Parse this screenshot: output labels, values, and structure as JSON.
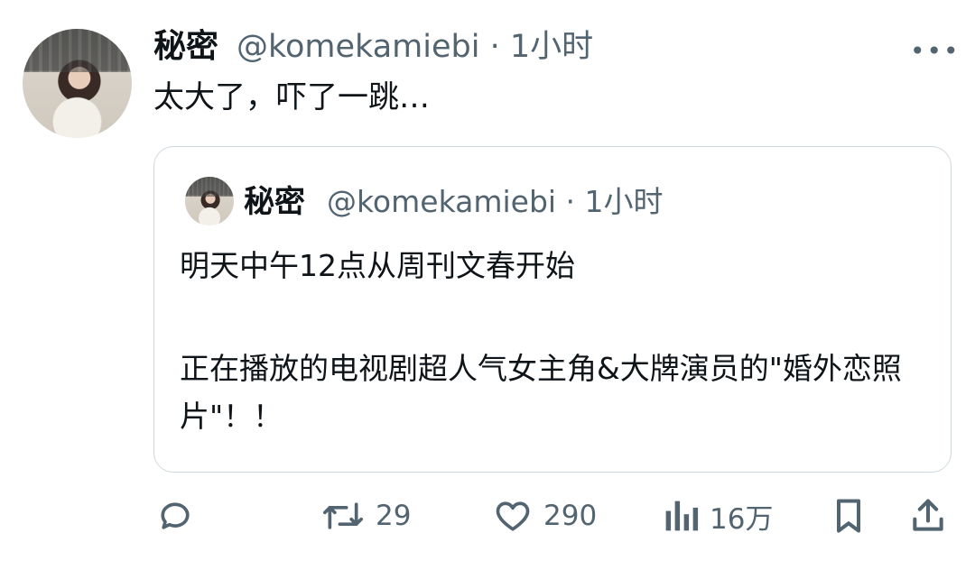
{
  "tweet": {
    "display_name": "秘密",
    "handle": "@komekamiebi",
    "time": "1小时",
    "text": "太大了，吓了一跳…",
    "more_icon": "more-horizontal-icon"
  },
  "quoted_tweet": {
    "display_name": "秘密",
    "handle": "@komekamiebi",
    "time": "1小时",
    "line1": "明天中午12点从周刊文春开始",
    "line2": "正在播放的电视剧超人气女主角&大牌演员的\"婚外恋照片\"！！"
  },
  "actions": {
    "reply": {
      "icon": "reply-icon"
    },
    "retweet": {
      "icon": "retweet-icon",
      "count": "29"
    },
    "like": {
      "icon": "heart-icon",
      "count": "290"
    },
    "views": {
      "icon": "views-icon",
      "count": "16万"
    },
    "bookmark": {
      "icon": "bookmark-icon"
    },
    "share": {
      "icon": "share-icon"
    }
  },
  "colors": {
    "text": "#0f1419",
    "secondary": "#536471",
    "border": "#cfd9de"
  }
}
